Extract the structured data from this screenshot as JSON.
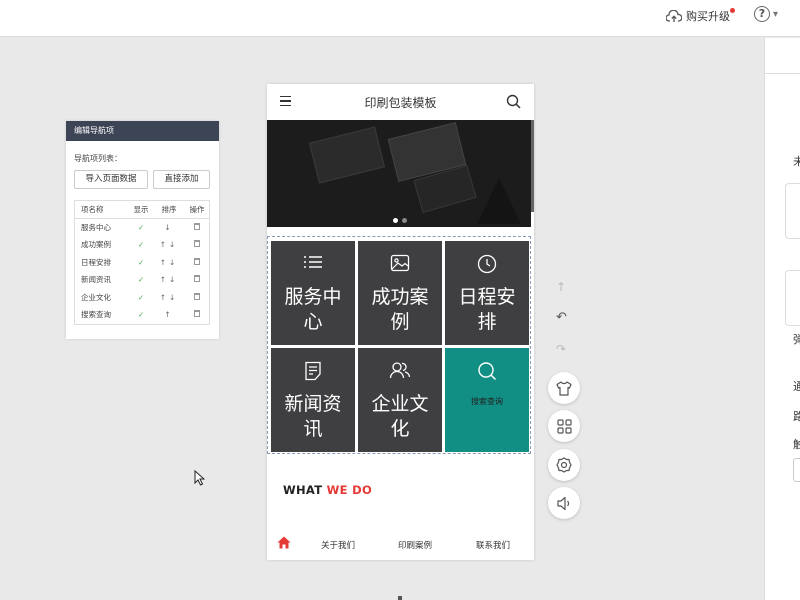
{
  "topbar": {
    "buy_label": "购买升级",
    "help_icon": "help-circle-icon",
    "colors": {
      "badge": "#e53935"
    }
  },
  "nav_panel": {
    "title": "编辑导航项",
    "list_label": "导航项列表：",
    "import_button": "导入页面数据",
    "add_button": "直接添加",
    "columns": [
      "项名称",
      "显示",
      "排序",
      "操作"
    ],
    "rows": [
      {
        "name": "服务中心",
        "show": "✓",
        "sort": "↓"
      },
      {
        "name": "成功案例",
        "show": "✓",
        "sort": "↑↓"
      },
      {
        "name": "日程安排",
        "show": "✓",
        "sort": "↑↓"
      },
      {
        "name": "新闻资讯",
        "show": "✓",
        "sort": "↑↓"
      },
      {
        "name": "企业文化",
        "show": "✓",
        "sort": "↑↓"
      },
      {
        "name": "搜索查询",
        "show": "✓",
        "sort": "↑"
      }
    ]
  },
  "phone": {
    "title": "印刷包装模板",
    "tiles": [
      {
        "label": "服务中心",
        "icon": "list-icon"
      },
      {
        "label": "成功案例",
        "icon": "image-icon"
      },
      {
        "label": "日程安排",
        "icon": "clock-icon"
      },
      {
        "label": "新闻资讯",
        "icon": "document-icon"
      },
      {
        "label": "企业文化",
        "icon": "people-icon"
      },
      {
        "label": "搜索查询",
        "icon": "search-icon"
      }
    ],
    "what_prefix": "WHAT ",
    "what_highlight": "WE DO",
    "tabbar": [
      "关于我们",
      "印刷案例",
      "联系我们"
    ],
    "colors": {
      "tile": "#3f3e40",
      "tile_active": "#128f85",
      "highlight": "#e53935",
      "home": "#e53935"
    }
  },
  "right_panel": {
    "chars": [
      "未",
      "弹",
      "通",
      "路",
      "触"
    ]
  }
}
